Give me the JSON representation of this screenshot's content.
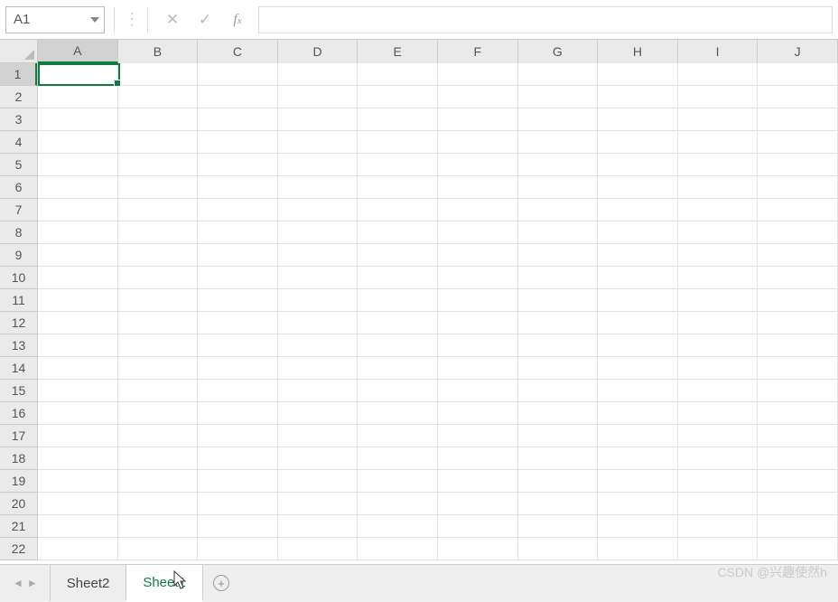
{
  "formula_bar": {
    "name_box": "A1",
    "formula_value": ""
  },
  "grid": {
    "columns": [
      "A",
      "B",
      "C",
      "D",
      "E",
      "F",
      "G",
      "H",
      "I",
      "J"
    ],
    "rows": [
      "1",
      "2",
      "3",
      "4",
      "5",
      "6",
      "7",
      "8",
      "9",
      "10",
      "11",
      "12",
      "13",
      "14",
      "15",
      "16",
      "17",
      "18",
      "19",
      "20",
      "21",
      "22"
    ],
    "active_cell": "A1",
    "selected_col_index": 0,
    "selected_row_index": 0
  },
  "sheet_tabs": {
    "tabs": [
      {
        "label": "Sheet2",
        "active": false
      },
      {
        "label": "Sheet1",
        "active": true
      }
    ]
  },
  "watermark": "CSDN @兴趣使然h"
}
